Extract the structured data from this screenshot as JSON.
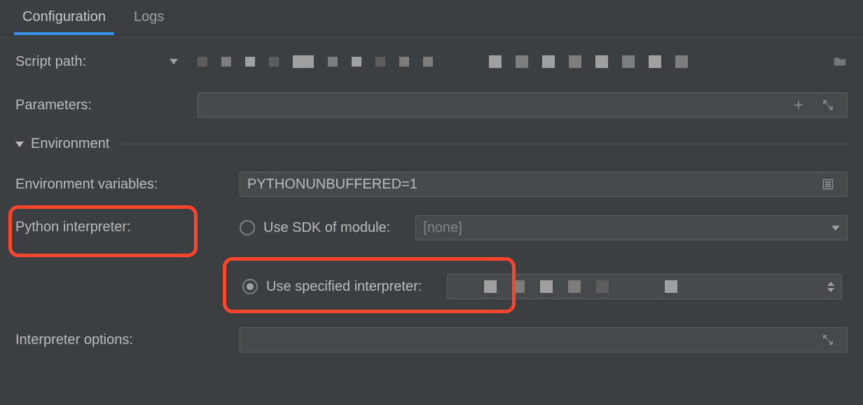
{
  "tabs": {
    "configuration": "Configuration",
    "logs": "Logs",
    "active": "configuration"
  },
  "form": {
    "script_path": {
      "label": "Script path:"
    },
    "parameters": {
      "label": "Parameters:"
    },
    "environment_section": "Environment",
    "env_vars": {
      "label": "Environment variables:",
      "value": "PYTHONUNBUFFERED=1"
    },
    "python_interpreter": {
      "label": "Python interpreter:",
      "use_sdk_label": "Use SDK of module:",
      "use_specified_label": "Use specified interpreter:",
      "sdk_value": "[none]",
      "selected": "specified"
    },
    "interpreter_options": {
      "label": "Interpreter options:"
    }
  }
}
